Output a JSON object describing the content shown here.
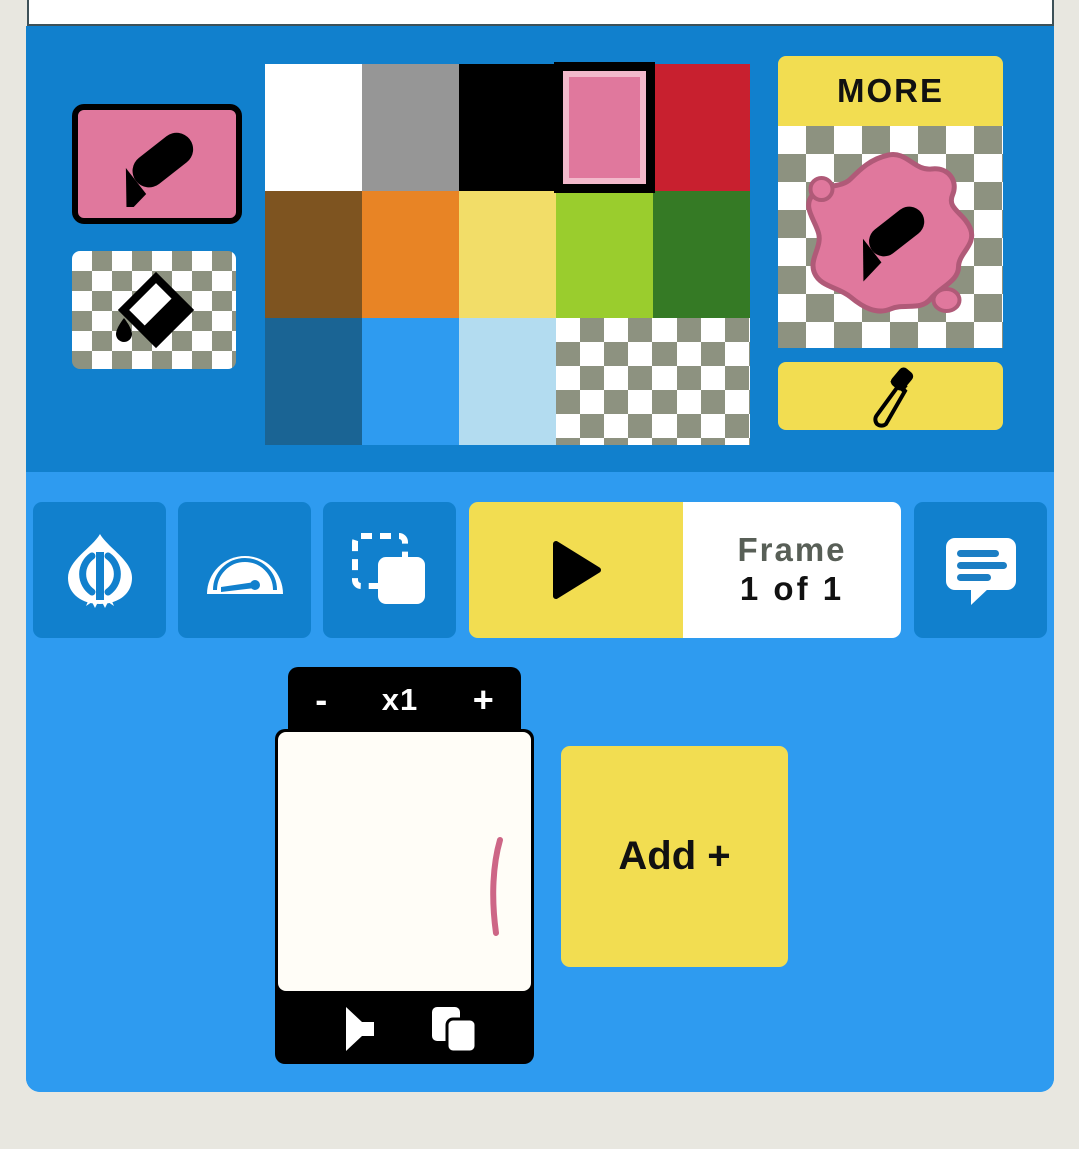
{
  "app": {
    "panel_background": "#2e9bf0",
    "palette_background": "#1180cd"
  },
  "palette": {
    "current_tool": {
      "name": "pencil-tool",
      "icon": "pencil-icon",
      "color": "#e0789d",
      "selected": true
    },
    "fill_tool": {
      "name": "fill-bucket-tool",
      "icon": "paint-bucket-icon",
      "color": "transparent"
    },
    "swatches": [
      {
        "color": "#ffffff",
        "name": "white",
        "checker": false,
        "selected": false
      },
      {
        "color": "#969696",
        "name": "gray",
        "checker": false,
        "selected": false
      },
      {
        "color": "#000000",
        "name": "black",
        "checker": false,
        "selected": false
      },
      {
        "color": "#e0789d",
        "name": "pink",
        "checker": false,
        "selected": true
      },
      {
        "color": "#c8202f",
        "name": "red",
        "checker": false,
        "selected": false
      },
      {
        "color": "#7e5420",
        "name": "brown",
        "checker": false,
        "selected": false
      },
      {
        "color": "#e88425",
        "name": "orange",
        "checker": false,
        "selected": false
      },
      {
        "color": "#f2dd68",
        "name": "yellow",
        "checker": false,
        "selected": false
      },
      {
        "color": "#9acd2d",
        "name": "light-green",
        "checker": false,
        "selected": false
      },
      {
        "color": "#357a25",
        "name": "dark-green",
        "checker": false,
        "selected": false
      },
      {
        "color": "#1a6494",
        "name": "dark-blue",
        "checker": false,
        "selected": false
      },
      {
        "color": "#2e9bf0",
        "name": "blue",
        "checker": false,
        "selected": false
      },
      {
        "color": "#b3dcf0",
        "name": "light-blue",
        "checker": false,
        "selected": false
      },
      {
        "color": "transparent",
        "name": "transparent-1",
        "checker": true,
        "selected": false
      },
      {
        "color": "transparent",
        "name": "transparent-2",
        "checker": true,
        "selected": false
      }
    ],
    "more_label": "MORE",
    "more_color": "#f2dd51",
    "preview": {
      "name": "brush-preview",
      "blob_color": "#e0789d",
      "blob_outline": "#b05a78",
      "icon": "pencil-icon"
    },
    "eyedropper": {
      "label": "",
      "icon": "eyedropper-icon",
      "color": "#f2dd51"
    }
  },
  "toolbar": {
    "buttons": [
      {
        "name": "undo-redo-button",
        "icon": "onion-skin-icon"
      },
      {
        "name": "speed-button",
        "icon": "speedometer-icon"
      },
      {
        "name": "select-button",
        "icon": "duplicate-selection-icon"
      },
      {
        "name": "comment-button",
        "icon": "speech-bubble-icon"
      }
    ],
    "play": {
      "name": "play-button",
      "icon": "play-triangle-icon",
      "color": "#f2dd51"
    },
    "frame_word": "Frame",
    "frame_count": "1 of 1"
  },
  "frames": {
    "zoom": {
      "minus": "-",
      "level": "x1",
      "plus": "+"
    },
    "thumbnail": {
      "name": "frame-thumbnail",
      "background": "#fffdf7",
      "stroke_color": "#cd6686"
    },
    "footer_icons": [
      {
        "name": "sound-icon"
      },
      {
        "name": "duplicate-frame-icon"
      }
    ],
    "add_label": "Add +",
    "add_color": "#f2dd51"
  }
}
